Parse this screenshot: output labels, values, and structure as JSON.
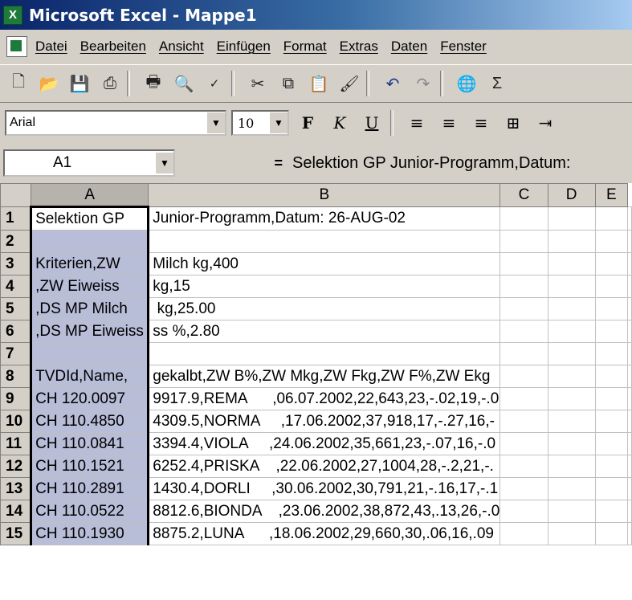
{
  "app": {
    "title": "Microsoft Excel - Mappe1"
  },
  "menu": [
    "Datei",
    "Bearbeiten",
    "Ansicht",
    "Einfügen",
    "Format",
    "Extras",
    "Daten",
    "Fenster"
  ],
  "toolbar": {
    "icons": [
      "new-icon",
      "open-icon",
      "save-icon",
      "permission-icon",
      "print-icon",
      "print-preview-icon",
      "spelling-icon",
      "cut-icon",
      "copy-icon",
      "paste-icon",
      "format-painter-icon",
      "undo-icon",
      "redo-icon",
      "hyperlink-icon",
      "autosum-icon"
    ],
    "autosum": "Σ"
  },
  "format": {
    "font": "Arial",
    "size": "10",
    "bold": "F",
    "italic": "K",
    "underline": "U"
  },
  "formula_bar": {
    "cell_ref": "A1",
    "equals": "=",
    "content": "Selektion GP Junior-Programm,Datum:"
  },
  "columns": [
    "A",
    "B",
    "C",
    "D",
    "E"
  ],
  "rows": [
    {
      "n": "1",
      "a": "Selektion GP",
      "b": "Junior-Programm,Datum: 26-AUG-02"
    },
    {
      "n": "2",
      "a": "",
      "b": ""
    },
    {
      "n": "3",
      "a": "Kriterien,ZW",
      "b": "Milch kg,400"
    },
    {
      "n": "4",
      "a": ",ZW Eiweiss",
      "b": "kg,15"
    },
    {
      "n": "5",
      "a": ",DS MP Milch",
      "b": " kg,25.00"
    },
    {
      "n": "6",
      "a": ",DS MP Eiweiss",
      "b": "ss %,2.80"
    },
    {
      "n": "7",
      "a": "",
      "b": ""
    },
    {
      "n": "8",
      "a": "TVDId,Name,",
      "b": "gekalbt,ZW B%,ZW Mkg,ZW Fkg,ZW F%,ZW Ekg"
    },
    {
      "n": "9",
      "a": "CH 120.0097",
      "b": "9917.9,REMA      ,06.07.2002,22,643,23,-.02,19,-.0"
    },
    {
      "n": "10",
      "a": "CH 110.4850",
      "b": "4309.5,NORMA     ,17.06.2002,37,918,17,-.27,16,-"
    },
    {
      "n": "11",
      "a": "CH 110.0841",
      "b": "3394.4,VIOLA     ,24.06.2002,35,661,23,-.07,16,-.0"
    },
    {
      "n": "12",
      "a": "CH 110.1521",
      "b": "6252.4,PRISKA    ,22.06.2002,27,1004,28,-.2,21,-."
    },
    {
      "n": "13",
      "a": "CH 110.2891",
      "b": "1430.4,DORLI     ,30.06.2002,30,791,21,-.16,17,-.1"
    },
    {
      "n": "14",
      "a": "CH 110.0522",
      "b": "8812.6,BIONDA    ,23.06.2002,38,872,43,.13,26,-.0"
    },
    {
      "n": "15",
      "a": "CH 110.1930",
      "b": "8875.2,LUNA      ,18.06.2002,29,660,30,.06,16,.09"
    }
  ]
}
